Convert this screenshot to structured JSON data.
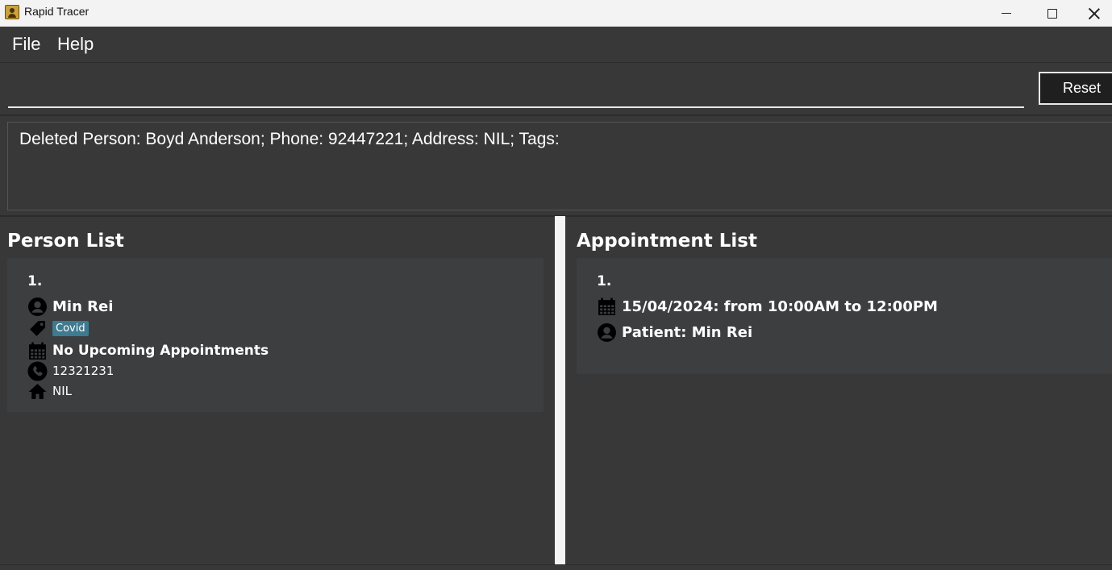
{
  "window": {
    "title": "Rapid Tracer"
  },
  "menu": {
    "items": [
      {
        "label": "File"
      },
      {
        "label": "Help"
      }
    ]
  },
  "command": {
    "value": "",
    "reset_label": "Reset"
  },
  "result": {
    "text": "Deleted Person: Boyd Anderson; Phone: 92447221; Address: NIL; Tags:"
  },
  "person_list": {
    "title": "Person List",
    "items": [
      {
        "index": "1.",
        "name": "Min Rei",
        "tags": [
          "Covid"
        ],
        "appointments": "No Upcoming Appointments",
        "phone": "12321231",
        "address": "NIL"
      }
    ]
  },
  "appointment_list": {
    "title": "Appointment List",
    "items": [
      {
        "index": "1.",
        "datetime": "15/04/2024: from 10:00AM to 12:00PM",
        "patient": "Patient: Min Rei"
      }
    ]
  },
  "colors": {
    "background": "#383838",
    "card": "#3c3e3f",
    "tag": "#3e7b91",
    "divider": "#f4f4f4"
  },
  "icons": [
    "person-icon",
    "tag-icon",
    "calendar-icon",
    "phone-icon",
    "home-icon"
  ]
}
